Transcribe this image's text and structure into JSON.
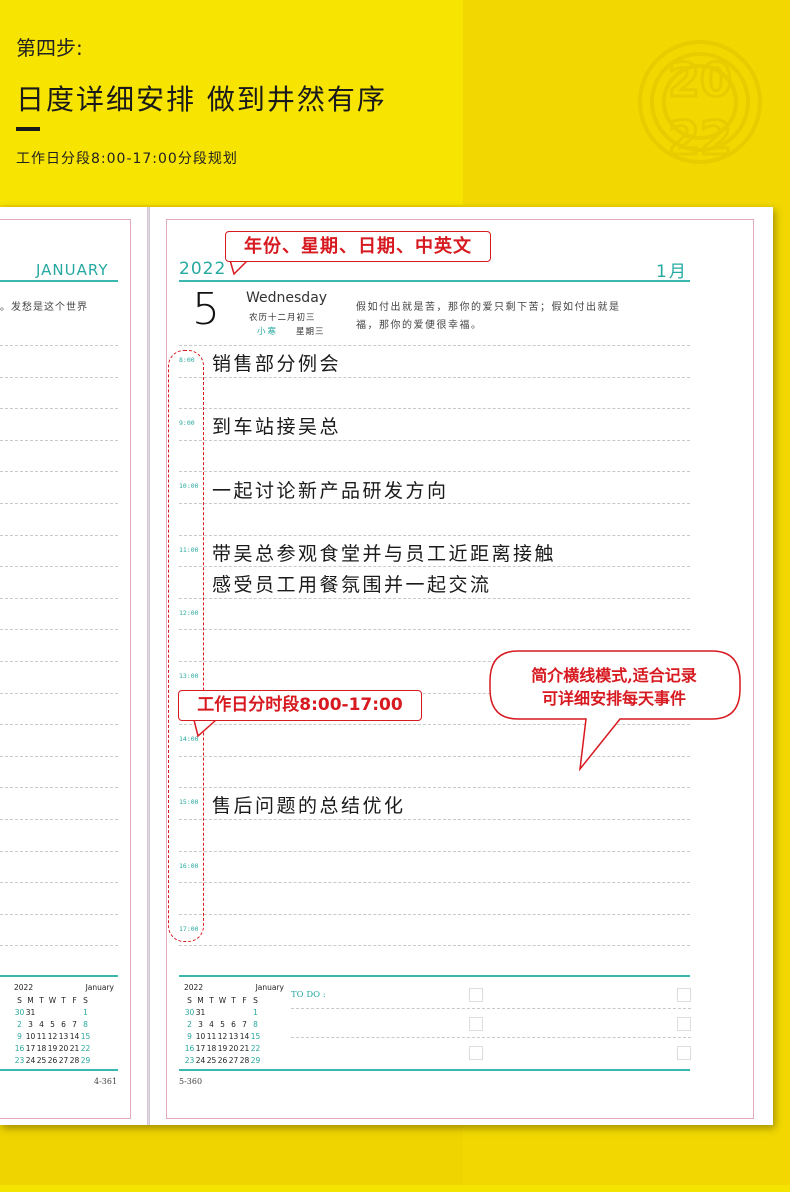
{
  "header": {
    "step": "第四步:",
    "headline": "日度详细安排 做到井然有序",
    "subtitle": "工作日分段8:00-17:00分段规划"
  },
  "logo": {
    "text": "2022"
  },
  "left_page": {
    "month_en": "JANUARY",
    "quote_fragment": "。发愁是这个世界",
    "page_number": "4-361",
    "mini_cal": {
      "year": "2022",
      "month": "January"
    }
  },
  "right_page": {
    "year": "2022",
    "month_cn": "1月",
    "day": "5",
    "weekday_en": "Wednesday",
    "lunar": "农历十二月初三",
    "solar_term": "小寒",
    "weekday_cn": "星期三",
    "quote_line1": "假如付出就是苦，那你的爱只剩下苦；假如付出就是",
    "quote_line2": "福，那你的爱便很幸福。",
    "hours": [
      "8:00",
      "9:00",
      "10:00",
      "11:00",
      "12:00",
      "13:00",
      "14:00",
      "15:00",
      "16:00",
      "17:00"
    ],
    "entries": [
      "销售部分例会",
      "到车站接吴总",
      "一起讨论新产品研发方向",
      "带吴总参观食堂并与员工近距离接触",
      "感受员工用餐氛围并一起交流",
      "售后问题的总结优化"
    ],
    "todo_label": "TO DO :",
    "page_number": "5-360",
    "mini_cal": {
      "year": "2022",
      "month": "January"
    }
  },
  "mini_calendar": {
    "weekdays": [
      "S",
      "M",
      "T",
      "W",
      "T",
      "F",
      "S"
    ],
    "rows": [
      [
        "30",
        "31",
        "",
        "",
        "",
        "",
        "1"
      ],
      [
        "2",
        "3",
        "4",
        "5",
        "6",
        "7",
        "8"
      ],
      [
        "9",
        "10",
        "11",
        "12",
        "13",
        "14",
        "15"
      ],
      [
        "16",
        "17",
        "18",
        "19",
        "20",
        "21",
        "22"
      ],
      [
        "23",
        "24",
        "25",
        "26",
        "27",
        "28",
        "29"
      ]
    ]
  },
  "callouts": {
    "date_info": "年份、星期、日期、中英文",
    "work_hours": "工作日分时段8:00-17:00",
    "note_line1": "简介横线模式,适合记录",
    "note_line2": "可详细安排每天事件"
  },
  "colors": {
    "accent": "#26a9a1",
    "callout": "#d71920",
    "background": "#f0d400"
  }
}
